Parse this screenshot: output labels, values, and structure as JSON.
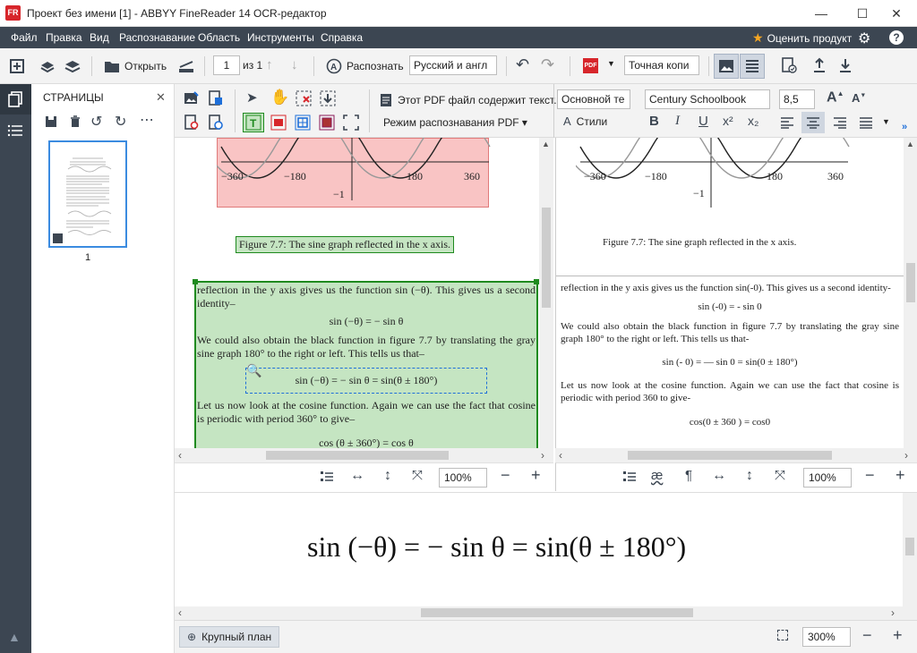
{
  "window": {
    "logo_text": "FR",
    "title": "Проект без имени [1] - ABBYY FineReader 14 OCR-редактор",
    "minimize": "—",
    "maximize": "☐",
    "close": "✕"
  },
  "menu": {
    "items": [
      "Файл",
      "Правка",
      "Вид",
      "Распознавание",
      "Область",
      "Инструменты",
      "Справка"
    ],
    "rate_product": "Оценить продукт"
  },
  "toolbar": {
    "open_label": "Открыть",
    "page_number": "1",
    "page_total": "из 1",
    "recognize_label": "Распознать",
    "language_value": "Русский и англ",
    "pdf_badge": "PDF",
    "copy_mode_value": "Точная копи"
  },
  "pages_panel": {
    "title": "СТРАНИЦЫ",
    "close": "✕",
    "page_label": "1"
  },
  "image_tools": {
    "pdf_notice": "Этот PDF файл содержит текст...",
    "pdf_mode": "Режим распознавания PDF ▾"
  },
  "text_tools": {
    "style_value": "Основной те",
    "font_value": "Century Schoolbook",
    "size_value": "8,5",
    "styles_label": "Стили",
    "superscript": "x²",
    "subscript": "x₂"
  },
  "image_view": {
    "graph_ticks": [
      "−360",
      "−180",
      "180",
      "360"
    ],
    "graph_minus_one": "−1",
    "caption": "Figure 7.7: The sine graph reflected in the x axis.",
    "p1": "reflection in the y axis gives us the function sin (−θ).  This gives us a second identity–",
    "eq1": "sin (−θ) = − sin θ",
    "p2": "We could also obtain the black function in figure 7.7 by translating the gray sine graph 180° to the right or left. This tells us that–",
    "eq2": "sin (−θ) = − sin θ = sin(θ ± 180°)",
    "p3": "Let us now look at the cosine function.  Again we can use the fact that cosine is periodic with period 360° to give–",
    "eq3": "cos (θ ± 360°) = cos θ",
    "zoom": "100%"
  },
  "text_view": {
    "graph_ticks": [
      "−360",
      "−180",
      "180",
      "360"
    ],
    "graph_minus_one": "−1",
    "caption": "Figure 7.7: The sine graph reflected in the x axis.",
    "p1": "reflection in the y axis gives us the function sin(-0). This gives us a second identity-",
    "eq1": "sin (-0) = - sin 0",
    "p2": "We could also obtain the black function in figure 7.7 by translating the gray sine graph 180° to the right or left. This tells us that-",
    "eq2": "sin (- 0) = — sin 0 = sin(0 ± 180°)",
    "p3": "Let us now look at the cosine function. Again we can use the fact that cosine is periodic with period 360    to give-",
    "eq3": "cos(0 ± 360   ) = cos0",
    "zoom": "100%"
  },
  "zoom_view": {
    "equation": "sin (−θ) = − sin θ = sin(θ ± 180°)"
  },
  "status": {
    "closeup_label": "Крупный план",
    "zoom": "300%"
  },
  "colors": {
    "menu_bg": "#3c4652",
    "picture_area": "#f9c4c4",
    "text_area": "#c5e5c2",
    "text_area_border": "#1f8a1f",
    "accent_blue": "#1e6fd9"
  }
}
